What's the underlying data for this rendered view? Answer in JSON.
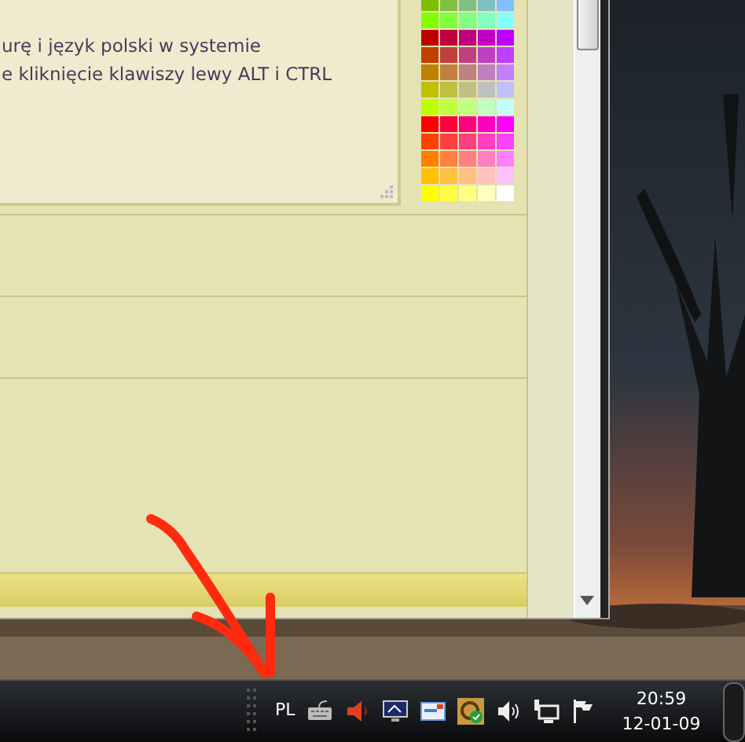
{
  "editor": {
    "lines": [
      "urę i język polski w systemie",
      "e kliknięcie klawiszy lewy ALT i CTRL"
    ]
  },
  "palette": {
    "rows": [
      {
        "swatches": [
          {
            "color": "#7fbf00"
          },
          {
            "color": "#80c040"
          },
          {
            "color": "#80c080"
          },
          {
            "color": "#80c0c0"
          },
          {
            "color": "#80c0ff"
          }
        ]
      },
      {
        "swatches": [
          {
            "color": "#80ff00"
          },
          {
            "color": "#80ff40"
          },
          {
            "color": "#80ff80"
          },
          {
            "color": "#80ffc0"
          },
          {
            "color": "#80ffff"
          }
        ]
      },
      {
        "swatches": [
          {
            "color": "#c00000"
          },
          {
            "color": "#c00040"
          },
          {
            "color": "#c00080"
          },
          {
            "color": "#c000c0"
          },
          {
            "color": "#c000ff"
          }
        ]
      },
      {
        "swatches": [
          {
            "color": "#c04000"
          },
          {
            "color": "#c04040"
          },
          {
            "color": "#c04080"
          },
          {
            "color": "#c040c0"
          },
          {
            "color": "#c040ff"
          }
        ]
      },
      {
        "swatches": [
          {
            "color": "#c08000"
          },
          {
            "color": "#c08040"
          },
          {
            "color": "#c08080"
          },
          {
            "color": "#c080c0"
          },
          {
            "color": "#c080ff"
          }
        ]
      },
      {
        "swatches": [
          {
            "color": "#c0c000"
          },
          {
            "color": "#c0c040"
          },
          {
            "color": "#c0c080"
          },
          {
            "color": "#c0c0c0"
          },
          {
            "color": "#c0c0ff"
          }
        ]
      },
      {
        "swatches": [
          {
            "color": "#c0ff00"
          },
          {
            "color": "#c0ff40"
          },
          {
            "color": "#c0ff80"
          },
          {
            "color": "#c0ffc0"
          },
          {
            "color": "#c0ffff"
          }
        ]
      },
      {
        "swatches": [
          {
            "color": "#ff0000"
          },
          {
            "color": "#ff0040"
          },
          {
            "color": "#ff0080"
          },
          {
            "color": "#ff00c0"
          },
          {
            "color": "#ff00ff"
          }
        ]
      },
      {
        "swatches": [
          {
            "color": "#ff4000"
          },
          {
            "color": "#ff4040"
          },
          {
            "color": "#ff4080"
          },
          {
            "color": "#ff40c0"
          },
          {
            "color": "#ff40ff"
          }
        ]
      },
      {
        "swatches": [
          {
            "color": "#ff8000"
          },
          {
            "color": "#ff8040"
          },
          {
            "color": "#ff8080"
          },
          {
            "color": "#ff80c0"
          },
          {
            "color": "#ff80ff"
          }
        ]
      },
      {
        "swatches": [
          {
            "color": "#ffc000"
          },
          {
            "color": "#ffc040"
          },
          {
            "color": "#ffc080"
          },
          {
            "color": "#ffc0c0"
          },
          {
            "color": "#ffc0ff"
          }
        ]
      },
      {
        "swatches": [
          {
            "color": "#ffff00"
          },
          {
            "color": "#ffff40"
          },
          {
            "color": "#ffff80"
          },
          {
            "color": "#ffffc0"
          },
          {
            "color": "#ffffff"
          }
        ]
      }
    ]
  },
  "taskbar": {
    "language": "PL",
    "clock": {
      "time": "20:59",
      "date": "12-01-09"
    }
  }
}
